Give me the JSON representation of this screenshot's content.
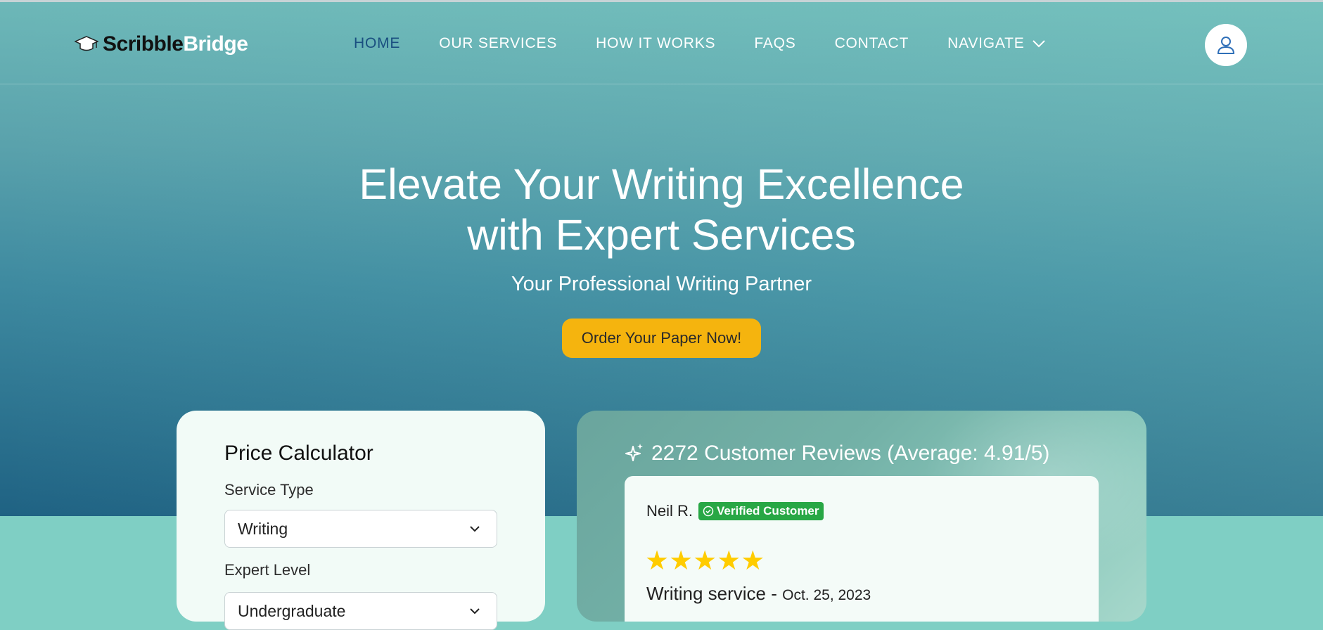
{
  "nav": {
    "logo_part1": "Scribble",
    "logo_part2": "Bridge",
    "links": [
      "HOME",
      "OUR SERVICES",
      "HOW IT WORKS",
      "FAQS",
      "CONTACT",
      "NAVIGATE"
    ],
    "active": "HOME",
    "icons": [
      "graduation-cap-icon",
      "chevron-down-icon",
      "user-icon"
    ]
  },
  "hero": {
    "title_line1": "Elevate Your Writing Excellence",
    "title_line2": "with Expert Services",
    "subtitle": "Your Professional Writing Partner",
    "cta_label": "Order Your Paper Now!"
  },
  "calculator": {
    "title": "Price Calculator",
    "service_type_label": "Service Type",
    "service_type_value": "Writing",
    "expert_level_label": "Expert Level",
    "expert_level_value": "Undergraduate"
  },
  "reviews": {
    "heading": "2272 Customer Reviews (Average: 4.91/5)",
    "review": {
      "name": "Neil R.",
      "badge": "Verified Customer",
      "rating_stars": 5,
      "stars": "★★★★★",
      "service": "Writing service -",
      "date": "Oct. 25, 2023"
    }
  },
  "colors": {
    "accent_cta": "#f5b40e",
    "nav_active": "#1a4f80",
    "badge_green": "#28a745",
    "star_yellow": "#ffcc00",
    "teal_bottom": "#7fcfc4"
  }
}
